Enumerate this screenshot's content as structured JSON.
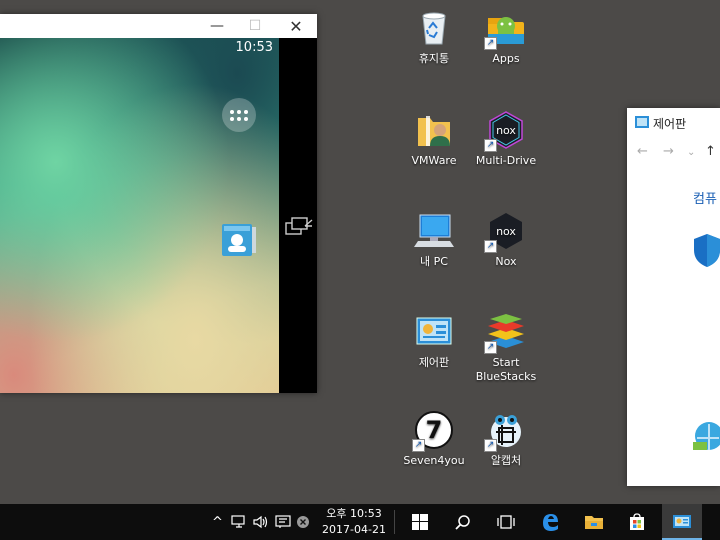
{
  "emulator": {
    "clock": "10:53",
    "window_buttons": {
      "minimize": "—",
      "maximize": "☐",
      "close": "✕"
    }
  },
  "desktop_icons": [
    {
      "label": "휴지통",
      "icon": "recycle-bin-icon"
    },
    {
      "label": "Apps",
      "icon": "apps-folder-icon"
    },
    {
      "label": "VMWare",
      "icon": "folder-icon"
    },
    {
      "label": "Multi-Drive",
      "icon": "nox-multi-drive-icon"
    },
    {
      "label": "내 PC",
      "icon": "computer-icon"
    },
    {
      "label": "Nox",
      "icon": "nox-icon"
    },
    {
      "label": "제어판",
      "icon": "control-panel-icon"
    },
    {
      "label": "Start BlueStacks",
      "icon": "bluestacks-icon"
    },
    {
      "label": "Seven4you",
      "icon": "seven4you-icon"
    },
    {
      "label": "알캡처",
      "icon": "alcapture-icon"
    }
  ],
  "control_panel": {
    "title": "제어판",
    "heading": "컴퓨"
  },
  "taskbar": {
    "time_line1": "오후 10:53",
    "time_line2": "2017-04-21",
    "tray_arrow": "^"
  },
  "colors": {
    "desktop": "#4c4a48",
    "taskbar": "#0d0d0d",
    "accent": "#1a5fb4"
  }
}
